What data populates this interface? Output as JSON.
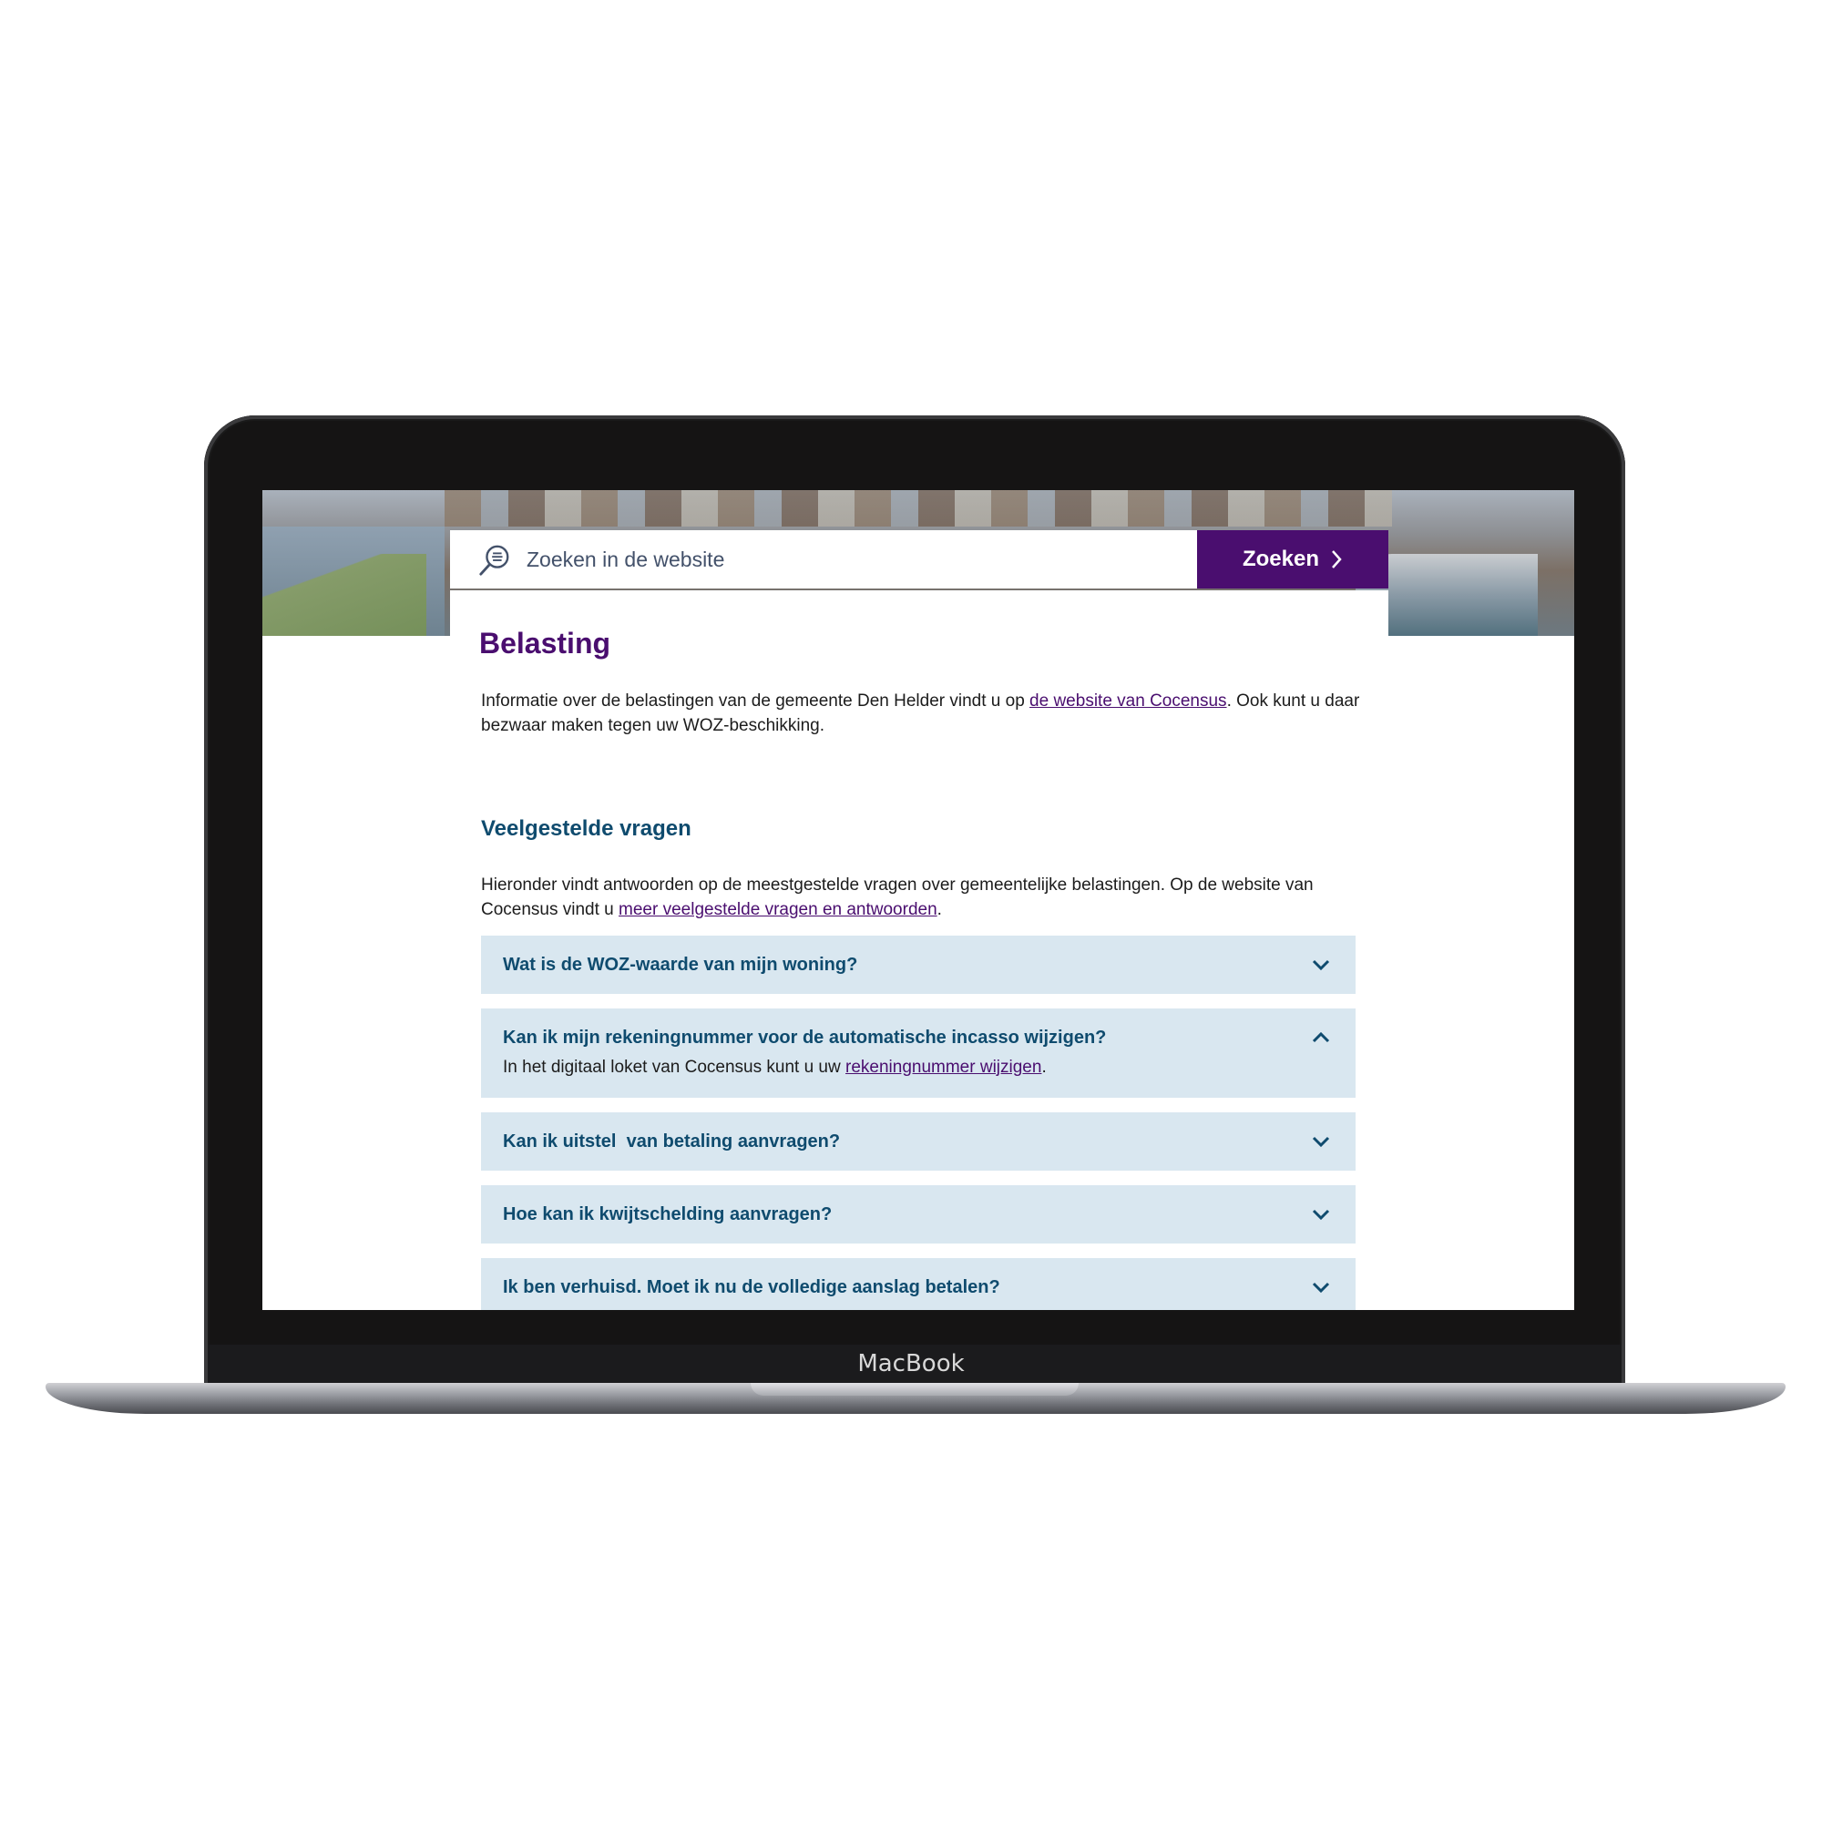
{
  "device": {
    "brand": "MacBook"
  },
  "search": {
    "placeholder": "Zoeken in de website",
    "button_label": "Zoeken"
  },
  "page": {
    "title": "Belasting",
    "intro_before": "Informatie over de belastingen van de gemeente Den Helder vindt u op ",
    "intro_link": "de website van Cocensus",
    "intro_after": ". Ook kunt u daar bezwaar maken tegen uw WOZ-beschikking."
  },
  "faq": {
    "heading": "Veelgestelde vragen",
    "intro_before": "Hieronder vindt antwoorden op de meestgestelde vragen over gemeentelijke belastingen. Op de website van Cocensus vindt u ",
    "intro_link": "meer veelgestelde vragen en antwoorden",
    "intro_after": ".",
    "items": [
      {
        "question": "Wat is de WOZ-waarde van mijn woning?",
        "expanded": false
      },
      {
        "question": "Kan ik mijn rekeningnummer voor de automatische incasso wijzigen?",
        "expanded": true,
        "answer_before": "In het digitaal loket van Cocensus kunt u uw ",
        "answer_link": "rekeningnummer wijzigen",
        "answer_after": "."
      },
      {
        "question": "Kan ik uitstel  van betaling aanvragen?",
        "expanded": false
      },
      {
        "question": "Hoe kan ik kwijtschelding aanvragen?",
        "expanded": false
      },
      {
        "question": "Ik ben verhuisd. Moet ik nu de volledige aanslag betalen?",
        "expanded": false
      }
    ]
  },
  "colors": {
    "brand_purple": "#4a0e6f",
    "heading_blue": "#0f4b6e",
    "accordion_bg": "#d9e7f0"
  }
}
